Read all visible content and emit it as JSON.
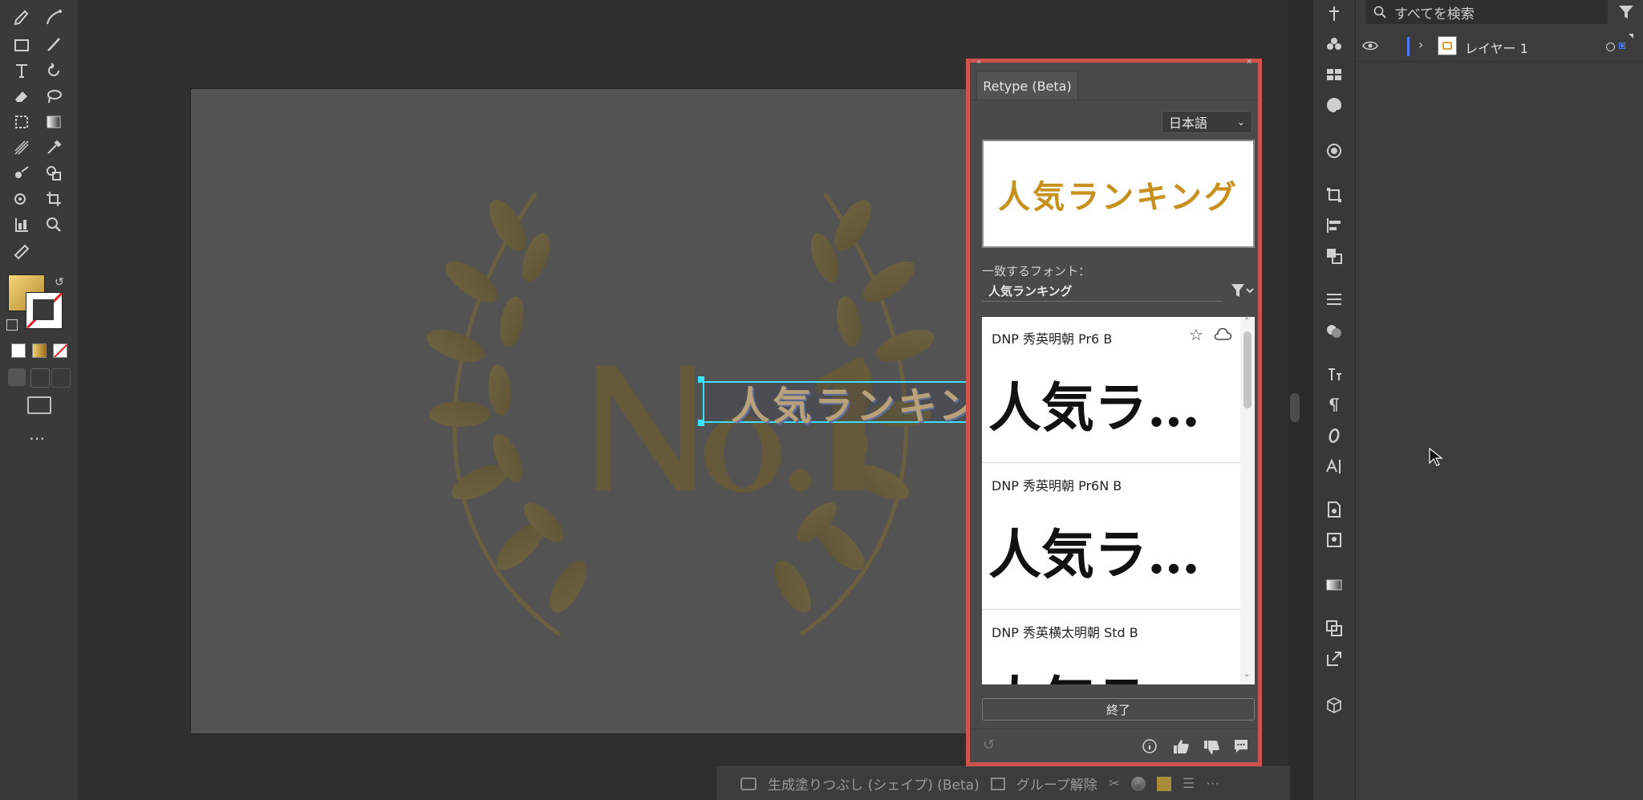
{
  "colors": {
    "accent_red": "#d0524d",
    "selection_cyan": "#39e1ff",
    "gold": "#c8901d"
  },
  "artboard": {
    "selected_text": "人気ランキング"
  },
  "bottom_bar": {
    "generative_fill": "生成塗りつぶし (シェイプ) (Beta)",
    "ungroup": "グループ解除"
  },
  "retype_panel": {
    "tab_title": "Retype (Beta)",
    "language": "日本語",
    "preview_text": "人気ランキング",
    "match_label": "一致するフォント：",
    "match_value": "人気ランキング",
    "fonts": [
      {
        "name": "DNP 秀英明朝 Pr6 B",
        "sample": "人気ラ…"
      },
      {
        "name": "DNP 秀英明朝 Pr6N B",
        "sample": "人気ラ…"
      },
      {
        "name": "DNP 秀英横太明朝 Std B",
        "sample": "人気ラ…"
      }
    ],
    "done_label": "終了"
  },
  "layers_panel": {
    "search_placeholder": "すべてを検索",
    "layer_name": "レイヤー 1"
  }
}
